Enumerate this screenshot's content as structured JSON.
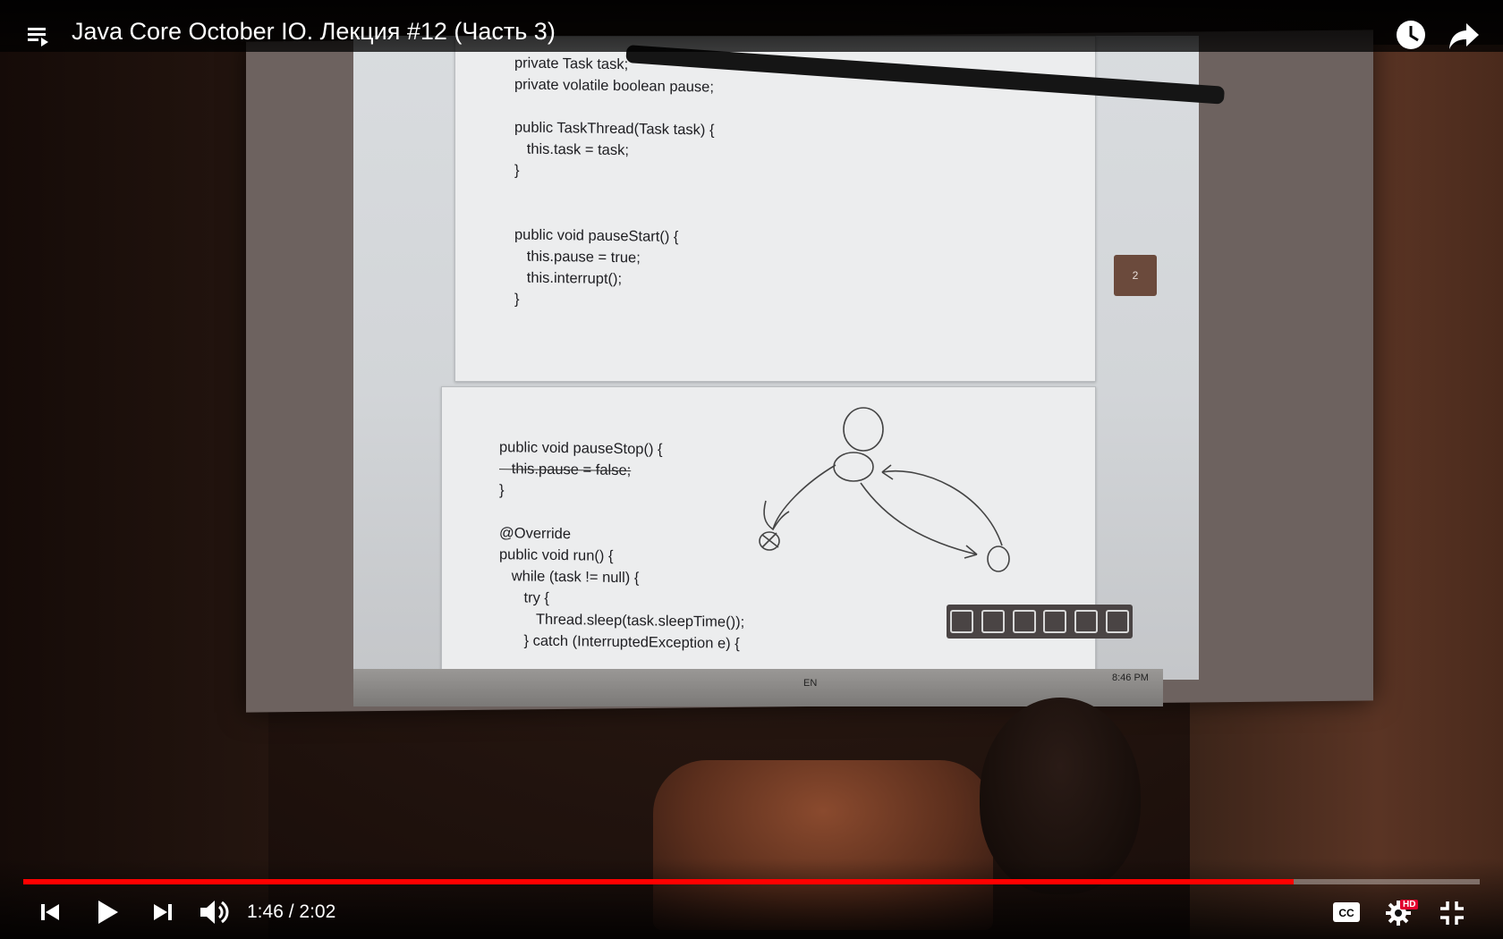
{
  "player": {
    "title": "Java Core October IO. Лекция #12 (Часть 3)",
    "time_current": "1:46",
    "time_separator": "/",
    "time_total": "2:02",
    "progress": 0.872,
    "hd_badge": "HD",
    "accent_color": "#ff0000"
  },
  "slide": {
    "page1_lines": [
      "private Task task;",
      "private volatile boolean pause;",
      "",
      "public TaskThread(Task task) {",
      "   this.task = task;",
      "}",
      "",
      "",
      "public void pauseStart() {",
      "   this.pause = true;",
      "   this.interrupt();",
      "}"
    ],
    "page2_lines": [
      "public void pauseStop() {",
      "   this.pause = false;",
      "}",
      "",
      "@Override",
      "public void run() {",
      "   while (task != null) {",
      "      try {",
      "         Thread.sleep(task.sleepTime());",
      "      } catch (InterruptedException e) {"
    ],
    "page_badge": "2",
    "taskbar_lang": "EN",
    "taskbar_clock": "8:46 PM"
  },
  "icons": {
    "playlist": "playlist-icon",
    "watch_later": "clock-icon",
    "share": "share-icon",
    "prev": "previous-icon",
    "play": "play-icon",
    "next": "next-icon",
    "volume": "volume-icon",
    "captions": "captions-icon",
    "settings": "gear-icon",
    "exit_fullscreen": "exit-fullscreen-icon"
  }
}
